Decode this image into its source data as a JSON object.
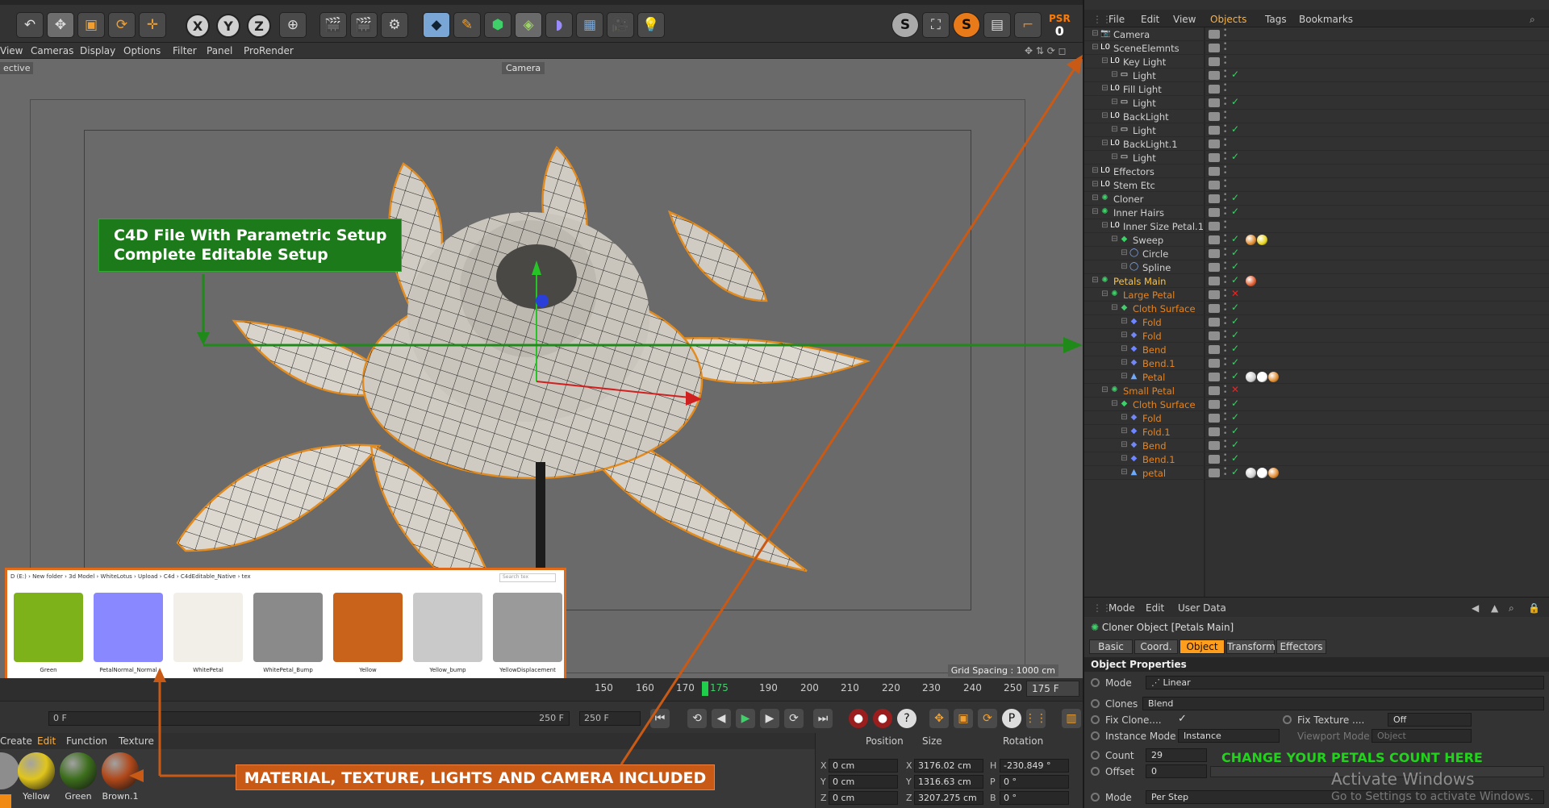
{
  "toolbar": {
    "xyz": [
      "X",
      "Y",
      "Z"
    ],
    "psr_label": "PSR",
    "psr_value": "0"
  },
  "viewport_menu": [
    "View",
    "Cameras",
    "Display",
    "Options",
    "Filter",
    "Panel",
    "ProRender"
  ],
  "viewport": {
    "view_label": "ective",
    "camera_label": "Camera",
    "grid_spacing": "Grid Spacing : 1000 cm"
  },
  "callouts": {
    "setup_line1": "C4D File With Parametric Setup",
    "setup_line2": "Complete Editable Setup",
    "materials": "MATERIAL, TEXTURE, LIGHTS AND CAMERA INCLUDED"
  },
  "file_browser": {
    "path": "D (E:)  ›  New folder  ›  3d Model  ›  WhiteLotus  ›  Upload  ›  C4d  ›  C4dEditable_Native  ›  tex",
    "search_placeholder": "Search tex",
    "files": [
      {
        "name": "Green",
        "color": "#7eb21a"
      },
      {
        "name": "PetalNormal_Normal",
        "color": "#8a88ff"
      },
      {
        "name": "WhitePetal",
        "color": "#f2efe9"
      },
      {
        "name": "WhitePetal_Bump",
        "color": "#8a8a8a"
      },
      {
        "name": "Yellow",
        "color": "#c9621a"
      },
      {
        "name": "Yellow_bump",
        "color": "#c9c9c9"
      },
      {
        "name": "YellowDisplacement",
        "color": "#9a9a9a"
      }
    ]
  },
  "timeline": {
    "ticks": [
      "150",
      "160",
      "170",
      "175",
      "190",
      "200",
      "210",
      "220",
      "230",
      "240",
      "250"
    ],
    "end_frame": "175 F"
  },
  "transport": {
    "start_frame": "0 F",
    "range_end": "250 F",
    "max_frame": "250 F"
  },
  "material_manager": {
    "menu": [
      "Create",
      "Edit",
      "Function",
      "Texture"
    ],
    "materials": [
      {
        "name": "Yellow",
        "color": "#e0c51c"
      },
      {
        "name": "Green",
        "color": "#3c6e1c"
      },
      {
        "name": "Brown.1",
        "color": "#b0481a"
      }
    ]
  },
  "coordinates": {
    "headers": [
      "Position",
      "Size",
      "Rotation"
    ],
    "rows": [
      {
        "axis": "X",
        "pos": "0 cm",
        "size_axis": "X",
        "size": "3176.02 cm",
        "rot_axis": "H",
        "rot": "-230.849 °"
      },
      {
        "axis": "Y",
        "pos": "0 cm",
        "size_axis": "Y",
        "size": "1316.63 cm",
        "rot_axis": "P",
        "rot": "0 °"
      },
      {
        "axis": "Z",
        "pos": "0 cm",
        "size_axis": "Z",
        "size": "3207.275 cm",
        "rot_axis": "B",
        "rot": "0 °"
      }
    ]
  },
  "object_manager": {
    "menu": [
      "File",
      "Edit",
      "View",
      "Objects",
      "Tags",
      "Bookmarks"
    ],
    "active_menu": "Objects",
    "objects": [
      {
        "name": "Camera",
        "depth": 0,
        "type": "camera",
        "color": "#d0d0d0"
      },
      {
        "name": "SceneElemnts",
        "depth": 0,
        "type": "null",
        "color": "#d0d0d0"
      },
      {
        "name": "Key Light",
        "depth": 1,
        "type": "null",
        "color": "#d0d0d0"
      },
      {
        "name": "Light",
        "depth": 2,
        "type": "light",
        "color": "#d0d0d0",
        "check": true
      },
      {
        "name": "Fill Light",
        "depth": 1,
        "type": "null",
        "color": "#d0d0d0"
      },
      {
        "name": "Light",
        "depth": 2,
        "type": "light",
        "color": "#d0d0d0",
        "check": true
      },
      {
        "name": "BackLight",
        "depth": 1,
        "type": "null",
        "color": "#d0d0d0"
      },
      {
        "name": "Light",
        "depth": 2,
        "type": "light",
        "color": "#d0d0d0",
        "check": true
      },
      {
        "name": "BackLight.1",
        "depth": 1,
        "type": "null",
        "color": "#d0d0d0"
      },
      {
        "name": "Light",
        "depth": 2,
        "type": "light",
        "color": "#d0d0d0",
        "check": true
      },
      {
        "name": "Effectors",
        "depth": 0,
        "type": "null",
        "color": "#d0d0d0"
      },
      {
        "name": "Stem Etc",
        "depth": 0,
        "type": "null",
        "color": "#d0d0d0"
      },
      {
        "name": "Cloner",
        "depth": 0,
        "type": "cloner",
        "color": "#d0d0d0",
        "check": true
      },
      {
        "name": "Inner Hairs",
        "depth": 0,
        "type": "cloner",
        "color": "#d0d0d0",
        "check": true
      },
      {
        "name": "Inner Size Petal.1",
        "depth": 1,
        "type": "null",
        "color": "#d0d0d0"
      },
      {
        "name": "Sweep",
        "depth": 2,
        "type": "sweep",
        "color": "#d0d0d0",
        "check": true,
        "tags": [
          "#e08a2c",
          "#e7d41a"
        ]
      },
      {
        "name": "Circle",
        "depth": 3,
        "type": "spline",
        "color": "#d0d0d0",
        "check": true
      },
      {
        "name": "Spline",
        "depth": 3,
        "type": "spline",
        "color": "#d0d0d0",
        "check": true
      },
      {
        "name": "Petals Main",
        "depth": 0,
        "type": "cloner",
        "color": "#ffc23d",
        "check": true,
        "tags": [
          "#e05a2c"
        ]
      },
      {
        "name": "Large Petal",
        "depth": 1,
        "type": "cloner",
        "color": "#e8831c",
        "cross": true
      },
      {
        "name": "Cloth Surface",
        "depth": 2,
        "type": "cloth",
        "color": "#e8831c",
        "check": true
      },
      {
        "name": "Fold",
        "depth": 3,
        "type": "deformer",
        "color": "#e8831c",
        "check": true
      },
      {
        "name": "Fold",
        "depth": 3,
        "type": "deformer",
        "color": "#e8831c",
        "check": true
      },
      {
        "name": "Bend",
        "depth": 3,
        "type": "deformer",
        "color": "#e8831c",
        "check": true
      },
      {
        "name": "Bend.1",
        "depth": 3,
        "type": "deformer",
        "color": "#e8831c",
        "check": true
      },
      {
        "name": "Petal",
        "depth": 3,
        "type": "poly",
        "color": "#e8831c",
        "check": true,
        "tags": [
          "#cfcfcf",
          "#ffffff",
          "#e08a2c"
        ]
      },
      {
        "name": "Small Petal",
        "depth": 1,
        "type": "cloner",
        "color": "#e8831c",
        "cross": true
      },
      {
        "name": "Cloth Surface",
        "depth": 2,
        "type": "cloth",
        "color": "#e8831c",
        "check": true
      },
      {
        "name": "Fold",
        "depth": 3,
        "type": "deformer",
        "color": "#e8831c",
        "check": true
      },
      {
        "name": "Fold.1",
        "depth": 3,
        "type": "deformer",
        "color": "#e8831c",
        "check": true
      },
      {
        "name": "Bend",
        "depth": 3,
        "type": "deformer",
        "color": "#e8831c",
        "check": true
      },
      {
        "name": "Bend.1",
        "depth": 3,
        "type": "deformer",
        "color": "#e8831c",
        "check": true
      },
      {
        "name": "petal",
        "depth": 3,
        "type": "poly",
        "color": "#e8831c",
        "check": true,
        "tags": [
          "#cfcfcf",
          "#ffffff",
          "#e08a2c"
        ]
      }
    ]
  },
  "attribute_manager": {
    "menu": [
      "Mode",
      "Edit",
      "User Data"
    ],
    "title": "Cloner Object [Petals Main]",
    "tabs": [
      "Basic",
      "Coord.",
      "Object",
      "Transform",
      "Effectors"
    ],
    "active_tab": "Object",
    "section": "Object Properties",
    "mode_label": "Mode",
    "mode_value": "Linear",
    "clones_label": "Clones",
    "clones_value": "Blend",
    "fix_clone_label": "Fix Clone....",
    "fix_texture_label": "Fix Texture ....",
    "fix_texture_value": "Off",
    "instance_mode_label": "Instance Mode",
    "instance_mode_value": "Instance",
    "viewport_mode_label": "Viewport Mode",
    "viewport_mode_value": "Object",
    "count_label": "Count",
    "count_value": "29",
    "offset_label": "Offset",
    "offset_value": "0",
    "mode2_label": "Mode",
    "mode2_value": "Per Step",
    "note": "CHANGE YOUR PETALS COUNT HERE"
  },
  "watermark": {
    "line1": "Activate Windows",
    "line2": "Go to Settings to activate Windows."
  }
}
